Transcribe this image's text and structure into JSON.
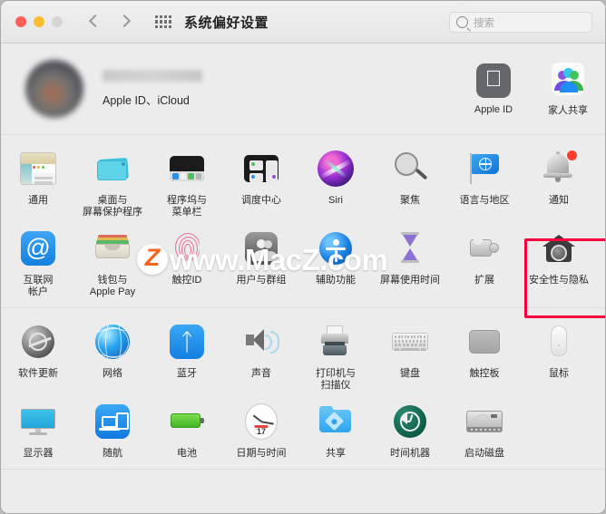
{
  "window": {
    "title": "系统偏好设置",
    "traffic_lights": [
      "close-button",
      "minimize-button",
      "zoom-button"
    ],
    "back_label": "‹",
    "forward_label": "›",
    "grid_label": "显示全部"
  },
  "search": {
    "placeholder": "搜索",
    "value": ""
  },
  "account": {
    "name_redacted": "",
    "subtitle": "Apple ID、iCloud",
    "tiles": [
      {
        "label": "Apple ID",
        "icon": "apple-logo-icon"
      },
      {
        "label": "家人共享",
        "icon": "family-sharing-icon"
      }
    ]
  },
  "sections": [
    {
      "name": "personal",
      "rows": [
        [
          {
            "label": "通用",
            "icon": "general-icon"
          },
          {
            "label": "桌面与\n屏幕保护程序",
            "icon": "desktop-screensaver-icon"
          },
          {
            "label": "程序坞与\n菜单栏",
            "icon": "dock-menubar-icon"
          },
          {
            "label": "调度中心",
            "icon": "mission-control-icon"
          },
          {
            "label": "Siri",
            "icon": "siri-icon"
          },
          {
            "label": "聚焦",
            "icon": "spotlight-icon"
          },
          {
            "label": "语言与地区",
            "icon": "language-region-icon"
          },
          {
            "label": "通知",
            "icon": "notifications-icon",
            "badge": true
          }
        ],
        [
          {
            "label": "互联网\n帐户",
            "icon": "internet-accounts-icon"
          },
          {
            "label": "钱包与\nApple Pay",
            "icon": "wallet-applepay-icon"
          },
          {
            "label": "触控ID",
            "icon": "touch-id-icon"
          },
          {
            "label": "用户与群组",
            "icon": "users-groups-icon"
          },
          {
            "label": "辅助功能",
            "icon": "accessibility-icon"
          },
          {
            "label": "屏幕使用时间",
            "icon": "screen-time-icon"
          },
          {
            "label": "扩展",
            "icon": "extensions-icon"
          },
          {
            "label": "安全性与隐私",
            "icon": "security-privacy-icon",
            "highlighted": true
          }
        ]
      ]
    },
    {
      "name": "hardware",
      "rows": [
        [
          {
            "label": "软件更新",
            "icon": "software-update-icon"
          },
          {
            "label": "网络",
            "icon": "network-icon"
          },
          {
            "label": "蓝牙",
            "icon": "bluetooth-icon"
          },
          {
            "label": "声音",
            "icon": "sound-icon"
          },
          {
            "label": "打印机与\n扫描仪",
            "icon": "printers-scanners-icon"
          },
          {
            "label": "键盘",
            "icon": "keyboard-icon"
          },
          {
            "label": "触控板",
            "icon": "trackpad-icon"
          },
          {
            "label": "鼠标",
            "icon": "mouse-icon"
          }
        ],
        [
          {
            "label": "显示器",
            "icon": "displays-icon"
          },
          {
            "label": "随航",
            "icon": "sidecar-icon"
          },
          {
            "label": "电池",
            "icon": "battery-icon"
          },
          {
            "label": "日期与时间",
            "icon": "date-time-icon",
            "clock_date": "17"
          },
          {
            "label": "共享",
            "icon": "sharing-icon"
          },
          {
            "label": "时间机器",
            "icon": "time-machine-icon"
          },
          {
            "label": "启动磁盘",
            "icon": "startup-disk-icon"
          }
        ]
      ]
    }
  ],
  "highlight": {
    "target": "安全性与隐私",
    "color": "#f5003c"
  },
  "watermark": {
    "logo": "Z",
    "text": "www.MacZ.com"
  },
  "colors": {
    "window_bg": "#ececec",
    "titlebar_bg": "#eeeeee",
    "accent_red": "#f5003c",
    "badge_red": "#ff3b30",
    "text": "#2b2b2b"
  }
}
